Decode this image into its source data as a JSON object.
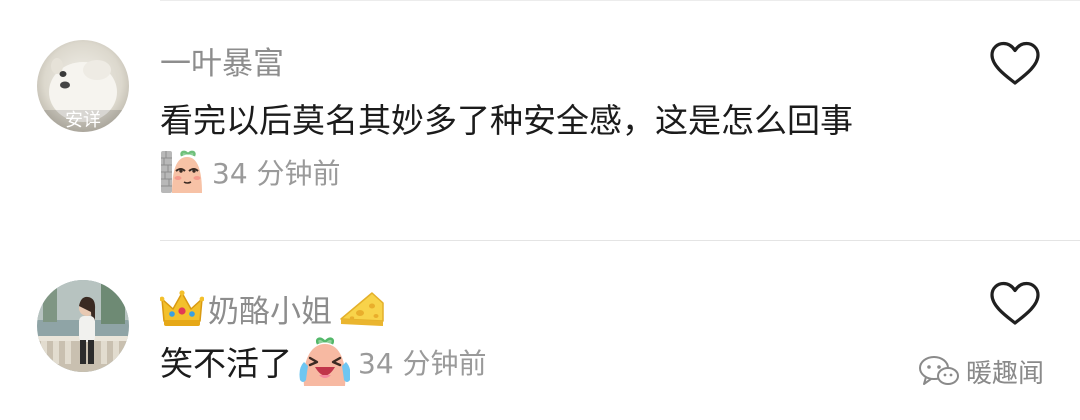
{
  "comments": [
    {
      "username": "一叶暴富",
      "avatar_label": "安详",
      "text": "看完以后莫名其妙多了种安全感，这是怎么回事",
      "sticker_icon": "peeking-peanut-sticker-icon",
      "timestamp": "34 分钟前",
      "like_icon": "heart-outline-icon"
    },
    {
      "username": "奶酪小姐",
      "username_prefix_icon": "crown-icon",
      "username_suffix_icon": "cheese-icon",
      "text": "笑不活了",
      "sticker_icon": "crying-laughing-peanut-sticker-icon",
      "timestamp": "34 分钟前",
      "like_icon": "heart-outline-icon"
    }
  ],
  "watermark": {
    "icon": "wechat-official-account-icon",
    "text": "暖趣闻"
  },
  "colors": {
    "username": "#8d8d8d",
    "comment_text": "#1b1b1b",
    "timestamp": "#9a9a9a",
    "divider": "#e4e4e4"
  }
}
